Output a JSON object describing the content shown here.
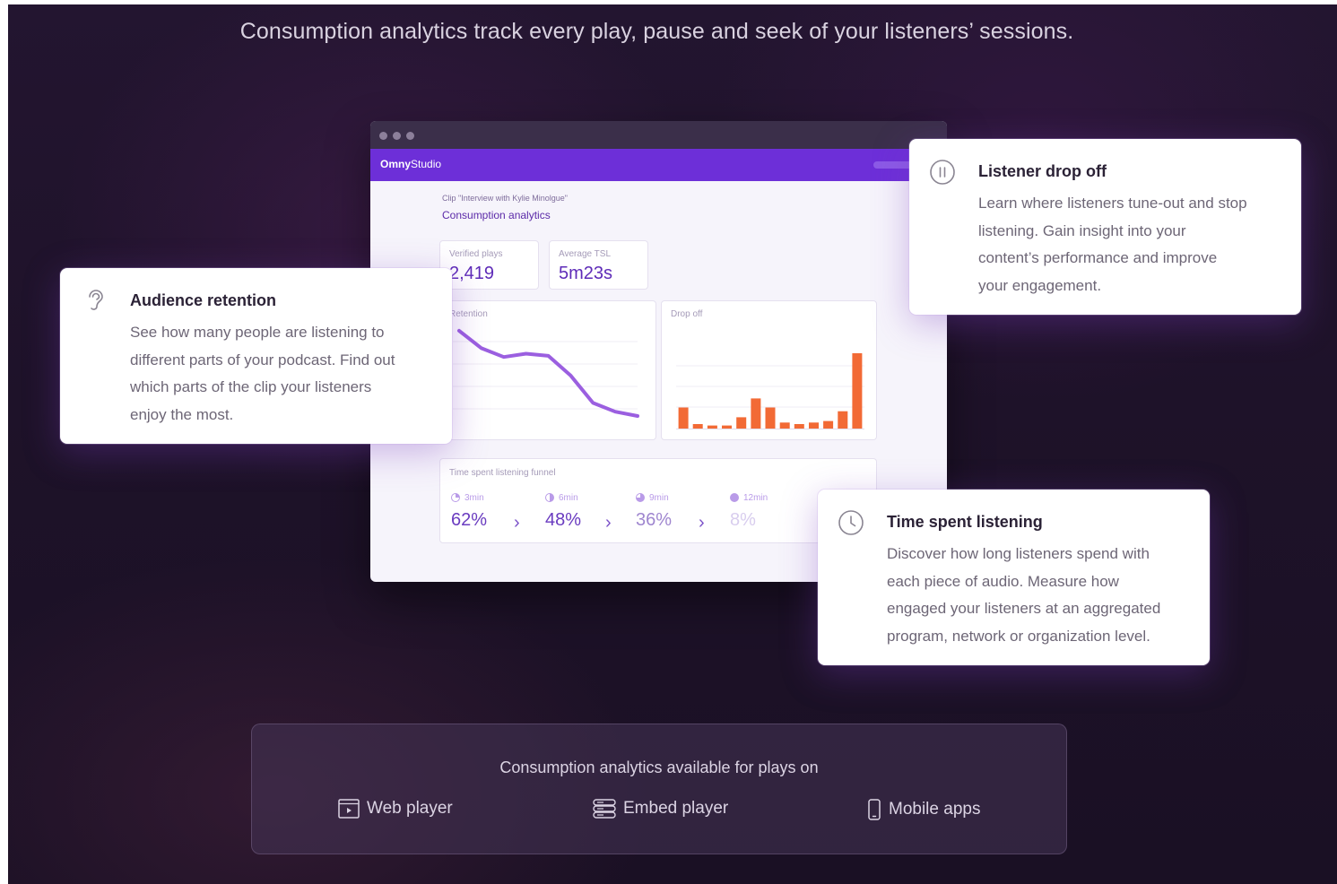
{
  "headline": "Consumption analytics track every play, pause and seek of your listeners’ sessions.",
  "studio": {
    "brand_bold": "Omny",
    "brand_light": "Studio",
    "crumb": "Clip \"Interview with Kylie Minolgue\"",
    "heading": "Consumption analytics",
    "stats": [
      {
        "label": "Verified plays",
        "value": "2,419"
      },
      {
        "label": "Average TSL",
        "value": "5m23s"
      }
    ],
    "retention_label": "Retention",
    "dropoff_label": "Drop off",
    "funnel": {
      "label": "Time spent listening funnel",
      "steps": [
        {
          "time": "3min",
          "value": "62%"
        },
        {
          "time": "6min",
          "value": "48%"
        },
        {
          "time": "9min",
          "value": "36%"
        },
        {
          "time": "12min",
          "value": "8%"
        }
      ]
    }
  },
  "chart_data": [
    {
      "type": "line",
      "title": "Retention",
      "x": [
        0,
        1,
        2,
        3,
        4,
        5,
        6,
        7,
        8
      ],
      "values": [
        96,
        80,
        72,
        75,
        73,
        55,
        30,
        22,
        18
      ],
      "ylim": [
        0,
        100
      ],
      "color": "#9b5fe0"
    },
    {
      "type": "bar",
      "title": "Drop off",
      "values": [
        28,
        6,
        4,
        4,
        15,
        40,
        28,
        8,
        6,
        8,
        10,
        23,
        100
      ],
      "ylim": [
        0,
        100
      ],
      "color": "#f26a35"
    }
  ],
  "cards": {
    "retention": {
      "title": "Audience retention",
      "lines": [
        "See how many people are listening to",
        "different parts of your podcast. Find out",
        "which parts of the clip your listeners",
        "enjoy the most."
      ],
      "icon": "ear-icon"
    },
    "dropoff": {
      "title": "Listener drop off",
      "lines": [
        "Learn where listeners tune-out and stop",
        "listening. Gain insight into your",
        "content’s performance and improve",
        "your engagement."
      ],
      "icon": "pause-circle-icon"
    },
    "time": {
      "title": "Time spent listening",
      "lines": [
        "Discover how long listeners spend with",
        "each piece of audio. Measure how",
        "engaged your listeners at an aggregated",
        "program, network or organization level."
      ],
      "icon": "clock-icon"
    }
  },
  "platforms": {
    "title": "Consumption analytics available for plays on",
    "items": [
      {
        "label": "Web player",
        "icon": "web-player-icon"
      },
      {
        "label": "Embed player",
        "icon": "embed-player-icon"
      },
      {
        "label": "Mobile apps",
        "icon": "mobile-phone-icon"
      }
    ]
  },
  "colors": {
    "accent": "#6d2fd8",
    "bar": "#f26a35",
    "line": "#9b5fe0"
  }
}
